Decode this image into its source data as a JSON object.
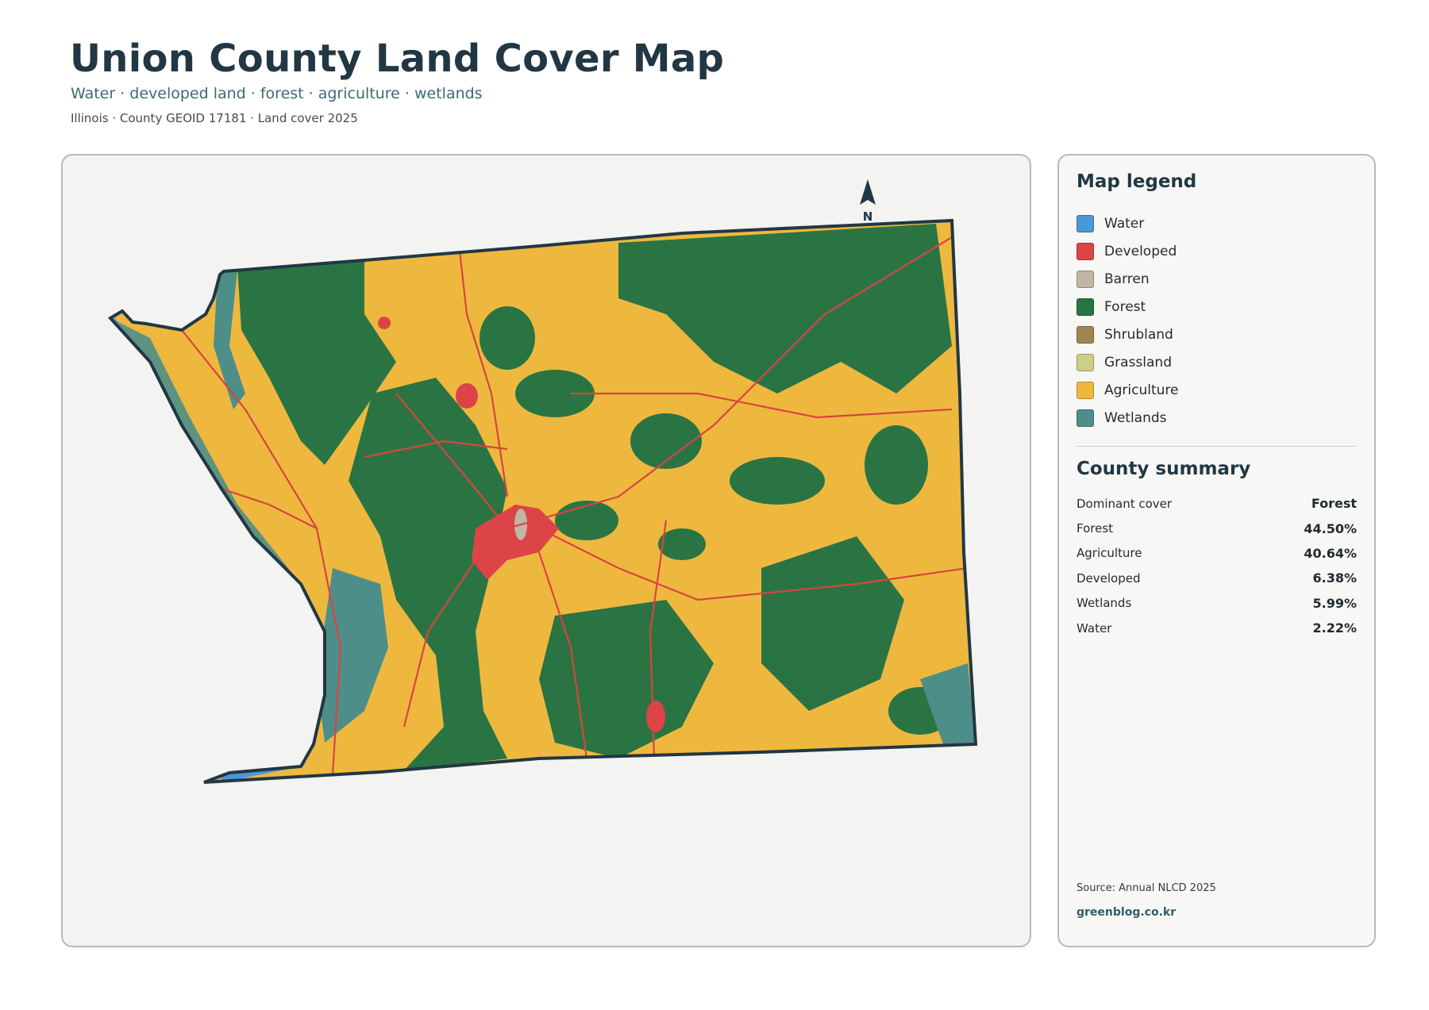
{
  "header": {
    "title": "Union County Land Cover Map",
    "subtitle": "Water · developed land · forest · agriculture · wetlands",
    "meta": "Illinois · County GEOID 17181 · Land cover 2025"
  },
  "map": {
    "north_arrow_label": "N",
    "colors": {
      "water": "#4a98d6",
      "developed": "#dc4448",
      "barren": "#bfb6a3",
      "forest": "#2a7444",
      "agriculture": "#eeb83f",
      "wetlands": "#4e8e88",
      "boundary": "#223744",
      "roads": "#d8453f"
    }
  },
  "legend": {
    "title": "Map legend",
    "items": [
      {
        "label": "Water",
        "color": "#4a98d6"
      },
      {
        "label": "Developed",
        "color": "#dc4448"
      },
      {
        "label": "Barren",
        "color": "#bfb6a3"
      },
      {
        "label": "Forest",
        "color": "#2a7444"
      },
      {
        "label": "Shrubland",
        "color": "#a08552"
      },
      {
        "label": "Grassland",
        "color": "#ccd084"
      },
      {
        "label": "Agriculture",
        "color": "#eeb83f"
      },
      {
        "label": "Wetlands",
        "color": "#4e8e88"
      }
    ]
  },
  "summary": {
    "title": "County summary",
    "rows": [
      {
        "label": "Dominant cover",
        "value": "Forest"
      },
      {
        "label": "Forest",
        "value": "44.50%"
      },
      {
        "label": "Agriculture",
        "value": "40.64%"
      },
      {
        "label": "Developed",
        "value": "6.38%"
      },
      {
        "label": "Wetlands",
        "value": "5.99%"
      },
      {
        "label": "Water",
        "value": "2.22%"
      }
    ]
  },
  "footer": {
    "source": "Source: Annual NLCD 2025",
    "credit": "greenblog.co.kr"
  }
}
